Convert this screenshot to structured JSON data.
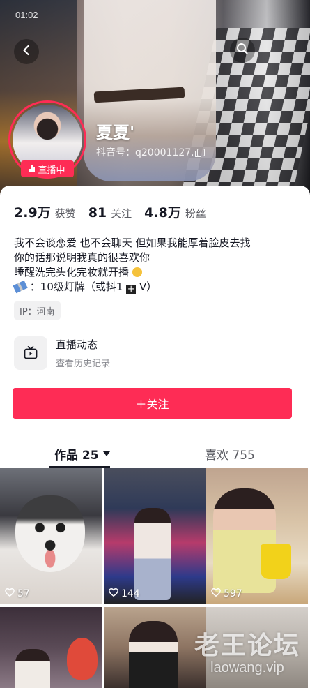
{
  "status_bar": {
    "time": "01:02"
  },
  "profile": {
    "nickname": "夏夏'",
    "douyin_id": "抖音号：q20001127.",
    "live_badge": "直播中"
  },
  "stats": [
    {
      "value": "2.9万",
      "label": "获赞"
    },
    {
      "value": "81",
      "label": "关注"
    },
    {
      "value": "4.8万",
      "label": "粉丝"
    }
  ],
  "bio": {
    "line1": "我不会谈恋爱 也不会聊天 但如果我能厚着脸皮去找",
    "line2": "你的话那说明我真的很喜欢你",
    "line3": "睡醒洗完头化完妆就开播",
    "line4_a": "：10级灯牌（或抖1",
    "line4_b": "V）"
  },
  "ip_tag": "IP：河南",
  "live_feed": {
    "title": "直播动态",
    "subtitle": "查看历史记录"
  },
  "follow_button": "＋关注",
  "tabs": {
    "works": "作品 25",
    "likes": "喜欢 755"
  },
  "videos": [
    {
      "likes": "57"
    },
    {
      "likes": "144"
    },
    {
      "likes": "597"
    },
    {
      "likes": ""
    },
    {
      "likes": ""
    },
    {
      "likes": ""
    }
  ],
  "watermark": {
    "big": "老王论坛",
    "small": "laowang.vip"
  },
  "colors": {
    "accent": "#fe2c55",
    "text": "#161823",
    "muted": "#8a8b91"
  }
}
